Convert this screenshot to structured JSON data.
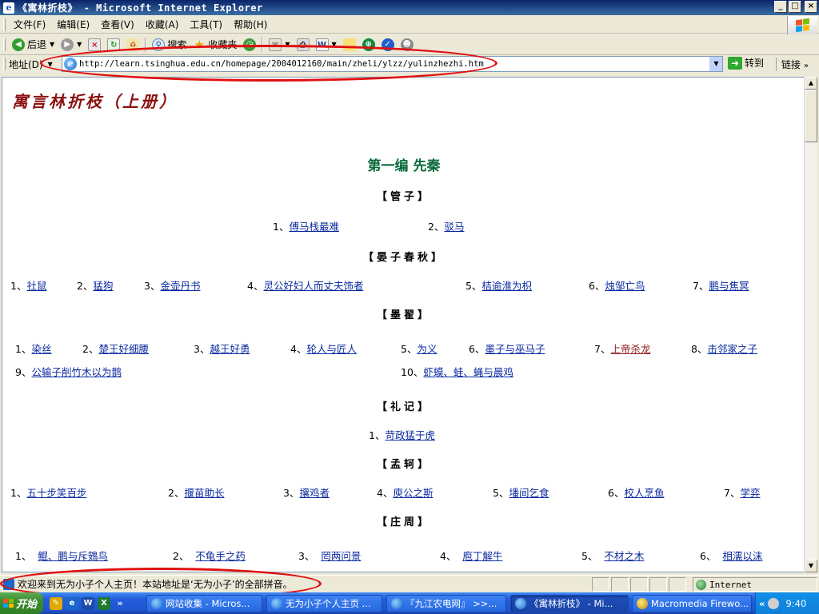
{
  "window": {
    "title": "《寓林折枝》 - Microsoft Internet Explorer"
  },
  "menu": [
    "文件(F)",
    "编辑(E)",
    "查看(V)",
    "收藏(A)",
    "工具(T)",
    "帮助(H)"
  ],
  "toolbar": {
    "back": "后退",
    "search": "搜索",
    "favorites": "收藏夹"
  },
  "address": {
    "label": "地址(D)",
    "url": "http://learn.tsinghua.edu.cn/homepage/2004012160/main/zheli/ylzz/yulinzhezhi.htm",
    "go": "转到",
    "links": "链接"
  },
  "page": {
    "title": "寓言林折枝（上册）",
    "part": "第一编  先秦",
    "sections": [
      {
        "name": "【管子】",
        "rows": [
          [
            {
              "num": "1、",
              "text": "傅马栈最难"
            },
            {
              "num": "2、",
              "text": "驳马"
            }
          ]
        ]
      },
      {
        "name": "【晏子春秋】",
        "rows": [
          [
            {
              "num": "1、",
              "text": "社鼠"
            },
            {
              "num": "2、",
              "text": "猛狗"
            },
            {
              "num": "3、",
              "text": "金壶丹书"
            },
            {
              "num": "4、",
              "text": "灵公好妇人而丈夫饰者"
            },
            {
              "num": "5、",
              "text": "桔逾淮为枳"
            },
            {
              "num": "6、",
              "text": "烛邹亡鸟"
            },
            {
              "num": "7、",
              "text": "鹏与焦冥"
            }
          ]
        ]
      },
      {
        "name": "【墨翟】",
        "rows": [
          [
            {
              "num": "1、",
              "text": "染丝"
            },
            {
              "num": "2、",
              "text": "楚王好细腰"
            },
            {
              "num": "3、",
              "text": "越王好勇"
            },
            {
              "num": "4、",
              "text": "轮人与匠人"
            },
            {
              "num": "5、",
              "text": "为义"
            },
            {
              "num": "6、",
              "text": "墨子与巫马子"
            },
            {
              "num": "7、",
              "text": "上帝杀龙"
            },
            {
              "num": "8、",
              "text": "击邻家之子"
            }
          ],
          [
            {
              "num": "9、",
              "text": "公输子削竹木以为鹊"
            },
            {
              "num": "10、",
              "text": "虾蟆、蛙、蝇与晨鸡"
            }
          ]
        ]
      },
      {
        "name": "【礼记】",
        "rows": [
          [
            {
              "num": "1、",
              "text": "苛政猛于虎"
            }
          ]
        ]
      },
      {
        "name": "【孟轲】",
        "rows": [
          [
            {
              "num": "1、",
              "text": "五十步笑百步"
            },
            {
              "num": "2、",
              "text": "揠苗助长"
            },
            {
              "num": "3、",
              "text": "攘鸡者"
            },
            {
              "num": "4、",
              "text": "庾公之斯"
            },
            {
              "num": "5、",
              "text": "墦间乞食"
            },
            {
              "num": "6、",
              "text": "校人烹鱼"
            },
            {
              "num": "7、",
              "text": "学弈"
            }
          ]
        ]
      },
      {
        "name": "【庄周】",
        "rows": [
          [
            {
              "num": "1、",
              "text": "鲲、鹏与斥鴳鸟"
            },
            {
              "num": "2、",
              "text": "不龟手之药"
            },
            {
              "num": "3、",
              "text": "罔两问景"
            },
            {
              "num": "4、",
              "text": "庖丁解牛"
            },
            {
              "num": "5、",
              "text": "不材之木"
            },
            {
              "num": "6、",
              "text": "相濡以沫"
            }
          ]
        ]
      }
    ]
  },
  "status": {
    "text": "欢迎来到无为小子个人主页！本站地址是‘无为小子’的全部拼音。",
    "zone": "Internet"
  },
  "taskbar": {
    "start": "开始",
    "tasks": [
      "网站收集 - Micros...",
      "无为小子个人主页 ...",
      "『九江农电网』 >>...",
      "《寓林折枝》 - Mi...",
      "Macromedia Firewo..."
    ],
    "clock": "9:40"
  }
}
